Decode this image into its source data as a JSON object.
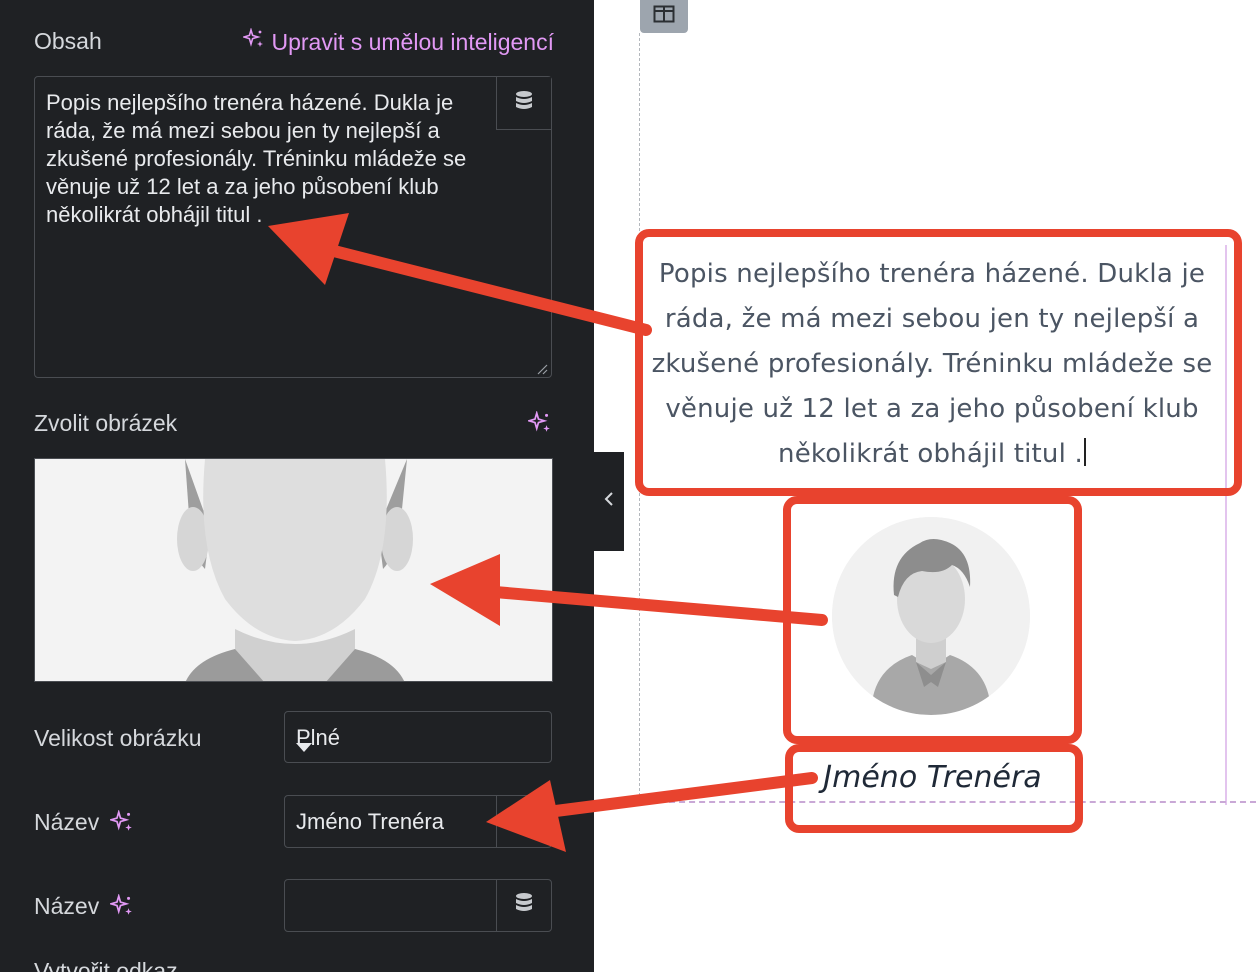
{
  "panel": {
    "content_label": "Obsah",
    "ai_edit_link": "Upravit s umělou inteligencí",
    "content_text": "Popis nejlepšího trenéra házené. Dukla je ráda, že má mezi sebou jen ty nejlepší a zkušené profesionály. Tréninku mládeže se věnuje už 12 let a za jeho působení klub několikrát obhájil titul .",
    "choose_image_label": "Zvolit obrázek",
    "image_size_label": "Velikost obrázku",
    "image_size_value": "Plné",
    "title_label": "Název",
    "title_value": "Jméno Trenéra",
    "title2_label": "Název",
    "title2_value": "",
    "link_label_partial": "Vytvořit odkaz"
  },
  "preview": {
    "text": "Popis nejlepšího trenéra házené. Dukla je ráda, že má mezi sebou jen ty nejlepší a zkušené profesionály. Tréninku mládeže se věnuje už 12 let a za jeho působení klub několikrát obhájil titul .",
    "caption": "Jméno Trenéra"
  },
  "icons": {
    "ai": "sparkle-icon",
    "dynamic": "database-icon",
    "dropdown": "caret-down-icon",
    "collapse": "chevron-left-icon",
    "layout": "columns-icon"
  },
  "colors": {
    "panel_bg": "#1f2124",
    "accent_ai": "#e299f5",
    "annotation_red": "#e8432e",
    "selection_outline": "#e3c4ee"
  }
}
